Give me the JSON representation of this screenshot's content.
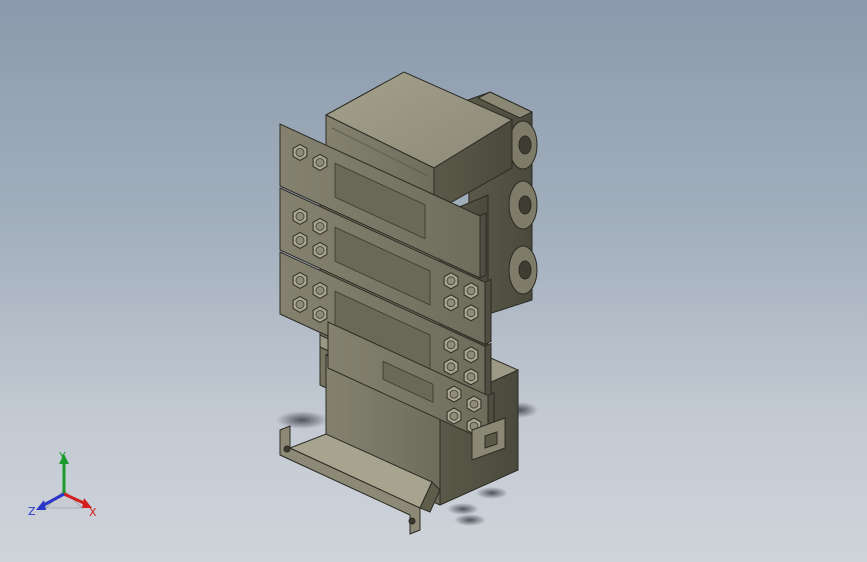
{
  "viewport": {
    "background_top": "#8b9aac",
    "background_bottom": "#cfd4da",
    "model_color": "#7c7a68"
  },
  "triad": {
    "x_label": "X",
    "y_label": "Y",
    "z_label": "Z",
    "x_color": "#d21e1e",
    "y_color": "#1a9a2a",
    "z_color": "#2a36c8"
  }
}
